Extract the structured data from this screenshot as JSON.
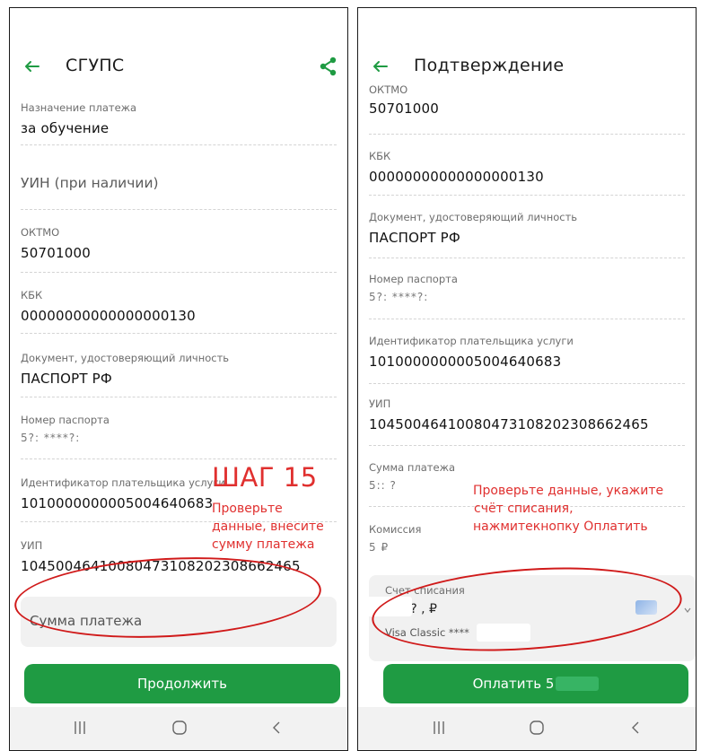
{
  "left": {
    "title": "СГУПС",
    "fields": [
      {
        "label": "Назначение платежа",
        "value": "за обучение"
      },
      {
        "placeholder": "УИН (при наличии)"
      },
      {
        "label": "ОКТМО",
        "value": "50701000"
      },
      {
        "label": "КБК",
        "value": "00000000000000000130"
      },
      {
        "label": "Документ, удостоверяющий личность",
        "value": "ПАСПОРТ РФ"
      },
      {
        "label": "Номер паспорта",
        "value": "5?"
      },
      {
        "label": "Идентификатор плательщика услуги",
        "value": "1010000000005004640683"
      },
      {
        "label": "УИП",
        "value": "10450046410080473108202308662465"
      }
    ],
    "masked_passport": "5?:  ****?:",
    "amount_placeholder": "Сумма платежа",
    "button": "Продолжить"
  },
  "right": {
    "title": "Подтверждение",
    "fields": [
      {
        "label": "ОКТМО",
        "value": "50701000"
      },
      {
        "label": "КБК",
        "value": "00000000000000000130"
      },
      {
        "label": "Документ, удостоверяющий личность",
        "value": "ПАСПОРТ РФ"
      },
      {
        "label": "Номер паспорта",
        "value": "5?"
      },
      {
        "label": "Идентификатор плательщика услуги",
        "value": "1010000000005004640683"
      },
      {
        "label": "УИП",
        "value": "10450046410080473108202308662465"
      },
      {
        "label": "Сумма платежа",
        "value": "5"
      },
      {
        "label": "Комиссия",
        "value": "5 ₽"
      }
    ],
    "masked_passport": "5?:  ****?:",
    "masked_sum": "5::  ?",
    "masked_commission": "5 ₽",
    "account_label": "Счет списания",
    "account_value": "·· ??? , ₽",
    "card_label": "Visa Classic ****",
    "button": "Оплатить 5"
  },
  "annotations": {
    "step": "ШАГ 15",
    "left_note": [
      "Проверьте",
      "данные, внесите",
      "сумму платежа"
    ],
    "right_note": [
      "Проверьте данные, укажите",
      "счёт списания,",
      "нажмитекнопку Оплатить"
    ]
  },
  "colors": {
    "accent": "#1f9b43",
    "annotation": "#e0302f"
  }
}
